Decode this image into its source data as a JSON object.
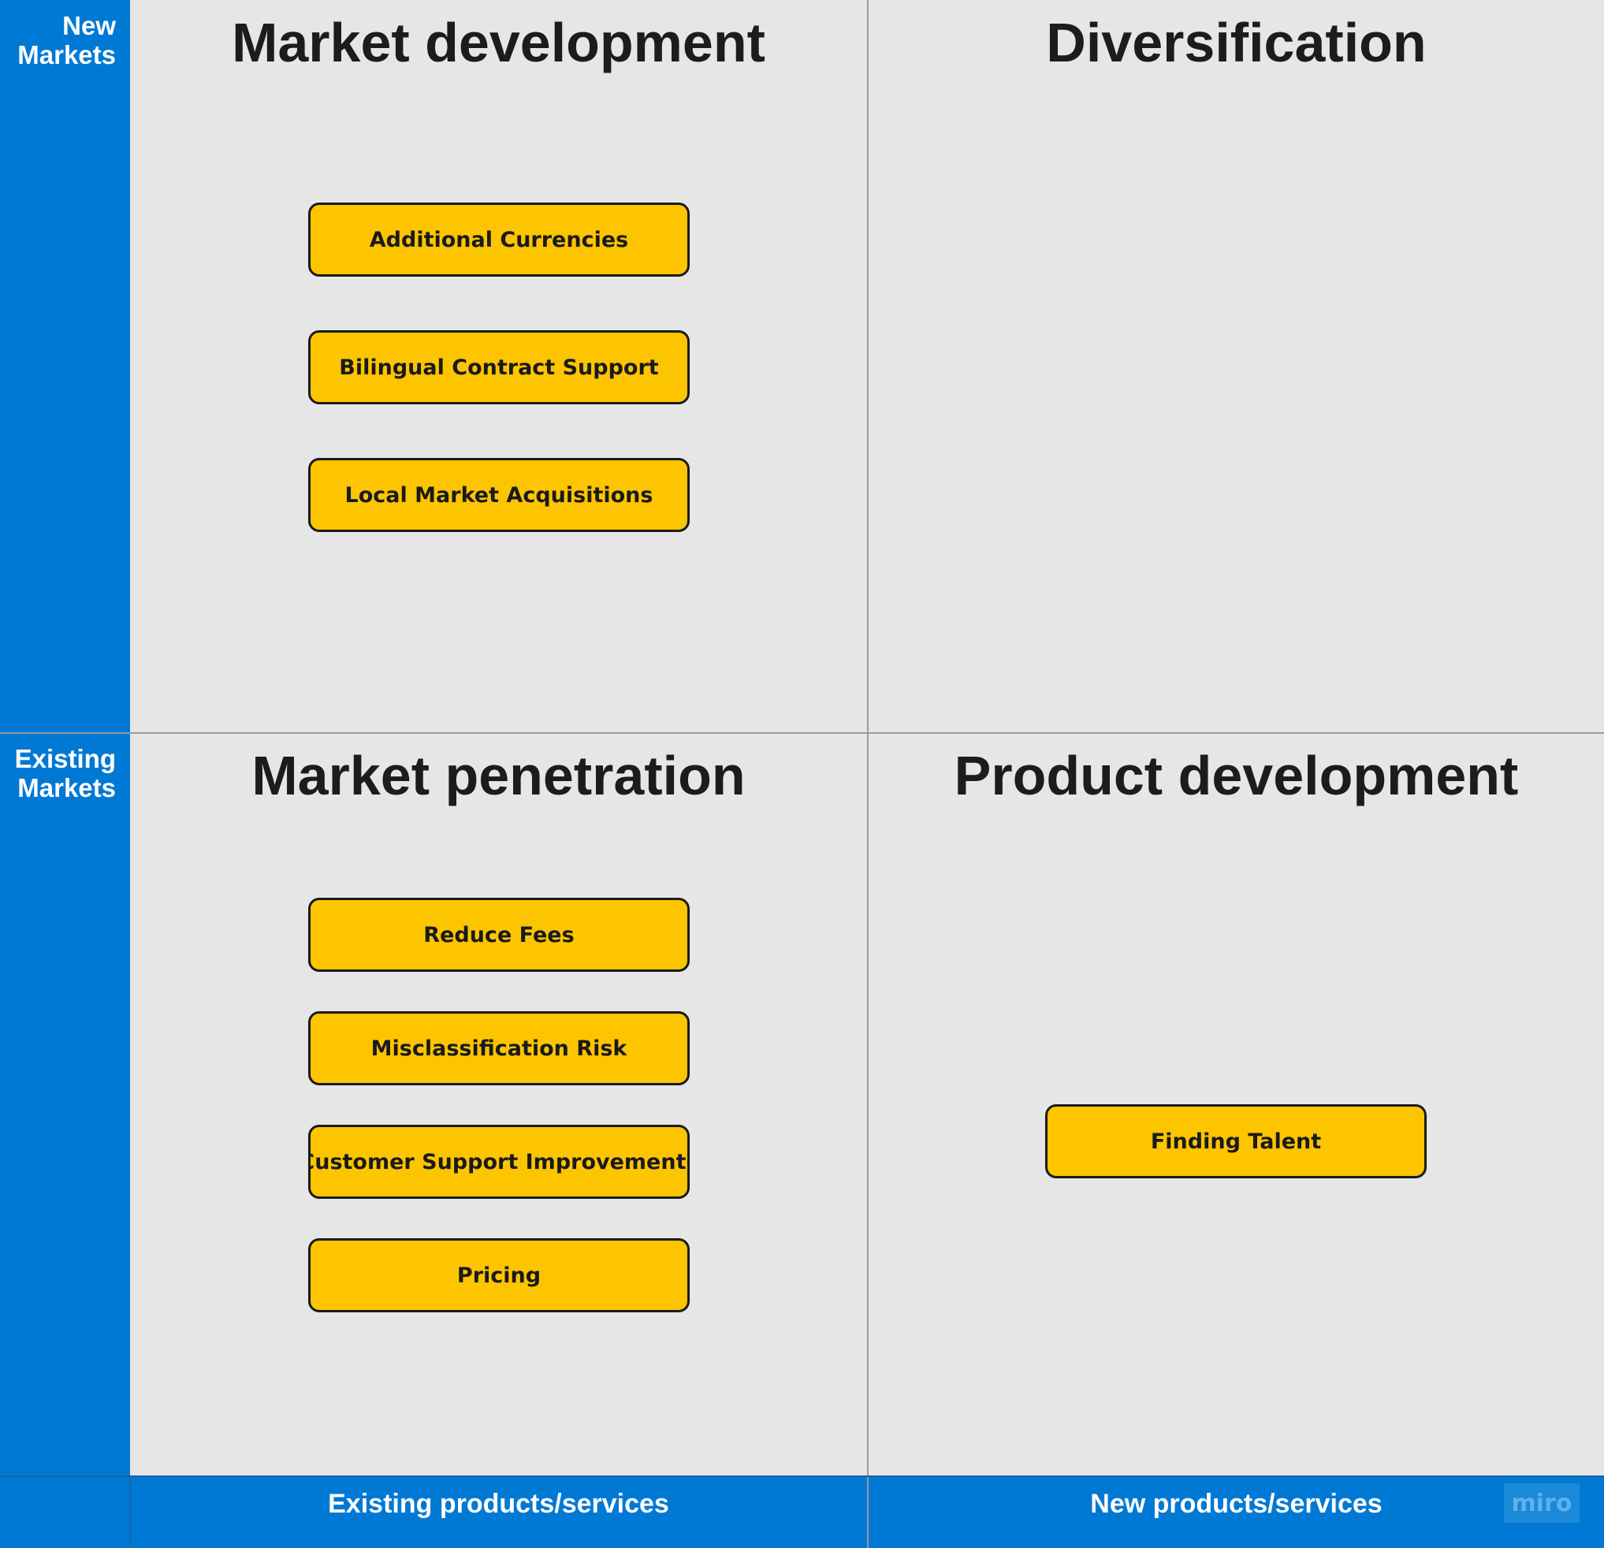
{
  "y_axis": {
    "top_label": "New\nMarkets",
    "bottom_label": "Existing\nMarkets"
  },
  "x_axis": {
    "left_label": "Existing products/services",
    "right_label": "New products/services"
  },
  "quadrants": {
    "market_development": {
      "title": "Market development",
      "items": [
        "Additional Currencies",
        "Bilingual Contract Support",
        "Local Market Acquisitions"
      ]
    },
    "diversification": {
      "title": "Diversification",
      "items": []
    },
    "market_penetration": {
      "title": "Market penetration",
      "items": [
        "Reduce Fees",
        "Misclassification Risk",
        "Customer Support Improvements",
        "Pricing"
      ]
    },
    "product_development": {
      "title": "Product development",
      "items": [
        "Finding Talent"
      ]
    }
  },
  "watermark": "miro",
  "colors": {
    "axis_bar": "#0079d4",
    "background": "#e6e6e6",
    "card_fill": "#fdc500",
    "card_border": "#1a1a1a"
  }
}
